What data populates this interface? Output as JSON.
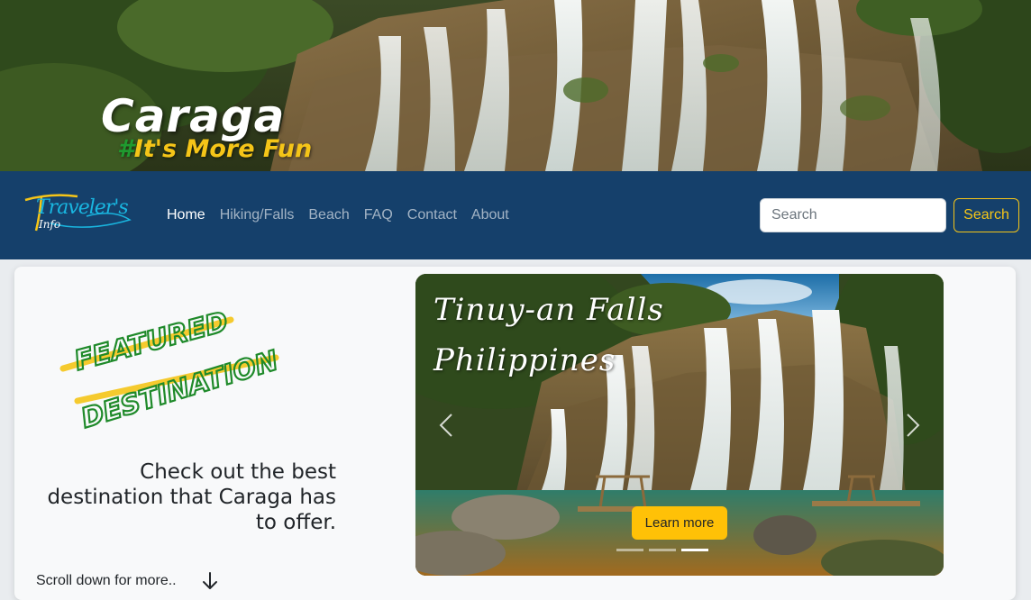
{
  "hero": {
    "title": "Caraga",
    "tagline_hash": "#",
    "tagline_rest": "It's More Fun"
  },
  "brand": {
    "name": "Traveler's",
    "sub": "Info"
  },
  "nav": {
    "links": [
      "Home",
      "Hiking/Falls",
      "Beach",
      "FAQ",
      "Contact",
      "About"
    ],
    "active": "Home"
  },
  "search": {
    "placeholder": "Search",
    "button_label": "Search"
  },
  "featured": {
    "line1": "FEATURED",
    "line2": "DESTINATION",
    "description": "Check out the best destination that Caraga has to offer.",
    "scroll_text": "Scroll down for more.."
  },
  "carousel": {
    "title_line1": "Tinuy-an Falls",
    "title_line2": "Philippines",
    "button_label": "Learn more",
    "slide_count": 3,
    "active_slide": 2
  },
  "colors": {
    "navbar": "#15406b",
    "accent_yellow": "#ffc107",
    "tagline_yellow": "#f5c518",
    "tagline_green": "#1f9a2f",
    "featured_green": "#1f8a2a"
  }
}
